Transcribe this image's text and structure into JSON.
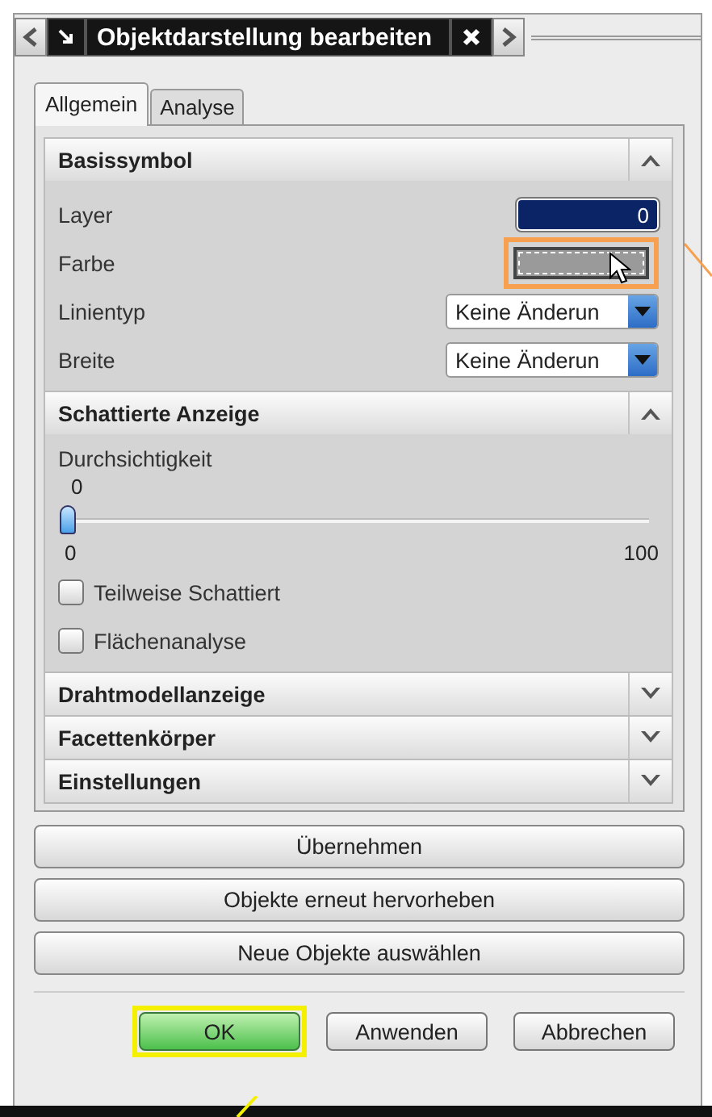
{
  "window": {
    "title": "Objektdarstellung bearbeiten"
  },
  "tabs": [
    {
      "label": "Allgemein",
      "selected": true
    },
    {
      "label": "Analyse",
      "selected": false
    }
  ],
  "sections": [
    {
      "title": "Basissymbol",
      "expanded": true,
      "rows": [
        {
          "kind": "number",
          "label": "Layer",
          "value": "0"
        },
        {
          "kind": "color",
          "label": "Farbe",
          "highlighted": true
        },
        {
          "kind": "dropdown",
          "label": "Linientyp",
          "value": "Keine Änderun"
        },
        {
          "kind": "dropdown",
          "label": "Breite",
          "value": "Keine Änderun"
        }
      ]
    },
    {
      "title": "Schattierte Anzeige",
      "expanded": true,
      "rows": [
        {
          "kind": "slider",
          "label": "Durchsichtigkeit",
          "reading": "0",
          "min": "0",
          "max": "100",
          "level": 0
        },
        {
          "kind": "checkbox",
          "label": "Teilweise Schattiert",
          "checked": false
        },
        {
          "kind": "checkbox",
          "label": "Flächenanalyse",
          "checked": false
        }
      ]
    },
    {
      "title": "Drahtmodellanzeige",
      "expanded": false
    },
    {
      "title": "Facettenkörper",
      "expanded": false
    },
    {
      "title": "Einstellungen",
      "expanded": false
    }
  ],
  "actions": [
    "Übernehmen",
    "Objekte erneut hervorheben",
    "Neue Objekte auswählen"
  ],
  "buttons": [
    {
      "label": "OK",
      "default": true,
      "highlighted": true
    },
    {
      "label": "Anwenden",
      "default": false,
      "highlighted": false
    },
    {
      "label": "Abbrechen",
      "default": false,
      "highlighted": false
    }
  ]
}
